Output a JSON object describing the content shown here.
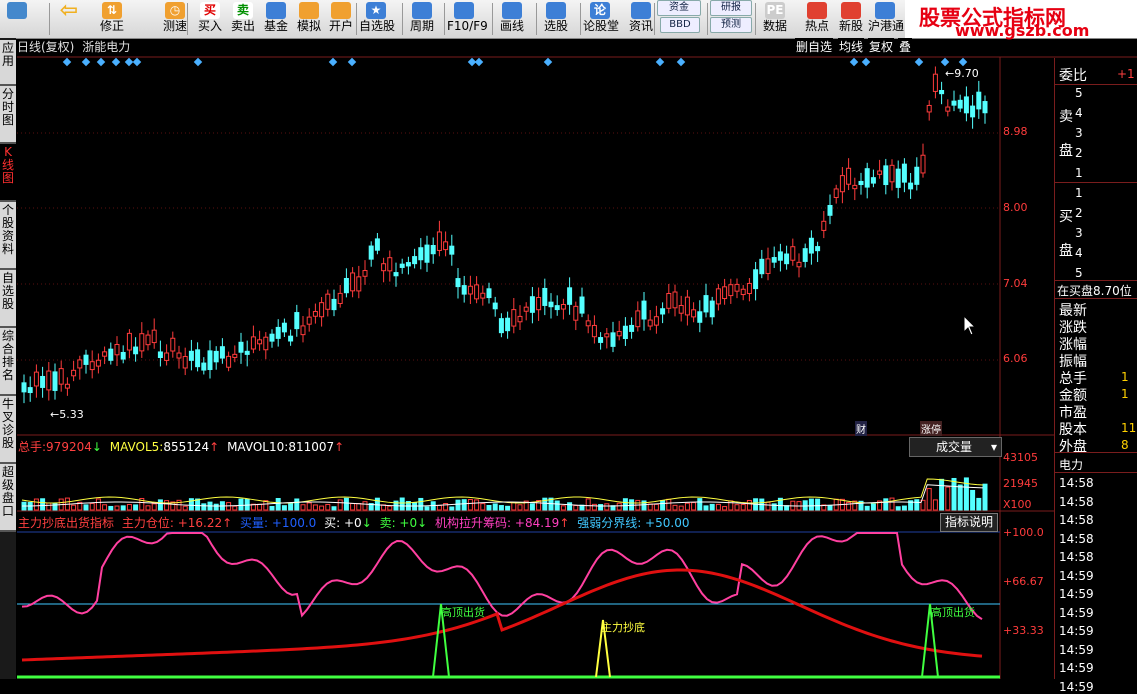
{
  "toolbar": {
    "items": [
      {
        "label": "",
        "icon": "app-icon"
      },
      {
        "label": "",
        "icon": "back-arrow-icon"
      },
      {
        "label": "修正",
        "icon": "arrow-updown-icon"
      },
      {
        "label": "测速",
        "icon": "clock-icon"
      },
      {
        "label": "买入",
        "icon": "buy-icon",
        "glyph": "买"
      },
      {
        "label": "卖出",
        "icon": "sell-icon",
        "glyph": "卖"
      },
      {
        "label": "基金",
        "icon": "fund-icon"
      },
      {
        "label": "模拟",
        "icon": "hammer-icon"
      },
      {
        "label": "开户",
        "icon": "account-icon"
      },
      {
        "label": "自选股",
        "icon": "star-icon"
      },
      {
        "label": "周期",
        "icon": "period-icon"
      },
      {
        "label": "F10/F9",
        "icon": "f10-icon"
      },
      {
        "label": "画线",
        "icon": "pen-icon"
      },
      {
        "label": "选股",
        "icon": "select-icon"
      },
      {
        "label": "论股堂",
        "icon": "forum-icon",
        "glyph": "论"
      },
      {
        "label": "资讯",
        "icon": "news-icon"
      },
      {
        "label": "数据",
        "icon": "pe-icon",
        "glyph": "PE"
      },
      {
        "label": "热点",
        "icon": "hot-icon"
      },
      {
        "label": "新股",
        "icon": "ipo-icon"
      },
      {
        "label": "沪港通",
        "icon": "hk-icon"
      }
    ],
    "mini_buttons": [
      "资金",
      "BBD",
      "研报",
      "预测"
    ]
  },
  "logo": {
    "title": "股票公式指标网",
    "url": "www.gszb.com"
  },
  "left_tabs": [
    "应用",
    "分时图",
    "K线图",
    "个股资料",
    "自选股",
    "综合排名",
    "牛叉诊股",
    "超级盘口"
  ],
  "kline": {
    "title_parts": [
      "日线(复权)",
      "浙能电力"
    ],
    "top_right_buttons": [
      "删自选",
      "均线",
      "复权",
      "叠"
    ],
    "high_label": "9.70",
    "low_label": "5.33",
    "price_ticks": [
      "8.98",
      "8.00",
      "7.04",
      "6.06"
    ],
    "event_badges": [
      "财",
      "涨停"
    ]
  },
  "volume": {
    "legend": [
      {
        "label": "总手:",
        "value": "979204",
        "arrow": "down",
        "color": "#ff4040"
      },
      {
        "label": "MAVOL5:",
        "value": "855124",
        "arrow": "up",
        "color": "#ffff40"
      },
      {
        "label": "MAVOL10:",
        "value": "811007",
        "arrow": "up",
        "color": "#ffffff"
      }
    ],
    "ticks": [
      "43105",
      "21945",
      "X100"
    ],
    "dropdown_label": "成交量"
  },
  "indicator": {
    "legend": [
      {
        "text": "主力抄底出货指标",
        "color": "#ff4040"
      },
      {
        "text": "主力仓位: +16.22",
        "arrow": "up",
        "color": "#ff4040"
      },
      {
        "text": "买量: +100.0",
        "color": "#2060ff"
      },
      {
        "text": "买: +0",
        "arrow": "down",
        "color": "#ffffff"
      },
      {
        "text": "卖: +0",
        "arrow": "down",
        "color": "#40ff40"
      },
      {
        "text": "机构拉升筹码: +84.19",
        "arrow": "up",
        "color": "#ff40c0"
      },
      {
        "text": "强弱分界线: +50.00",
        "color": "#40c8ff"
      }
    ],
    "ticks": [
      "+100.0",
      "+66.67",
      "+33.33"
    ],
    "signals": [
      "高顶出货",
      "主力抄底",
      "高顶出货"
    ],
    "explain_button": "指标说明"
  },
  "right_panel": {
    "weibi_label": "委比",
    "weibi_value": "+1",
    "sell_label_1": "卖",
    "sell_label_2": "盘",
    "sell_levels": [
      "5",
      "4",
      "3",
      "2",
      "1"
    ],
    "buy_label_1": "买",
    "buy_label_2": "盘",
    "buy_levels": [
      "1",
      "2",
      "3",
      "4",
      "5"
    ],
    "buy_queue": "在买盘8.70位",
    "stats": [
      {
        "label": "最新",
        "value": ""
      },
      {
        "label": "涨跌",
        "value": ""
      },
      {
        "label": "涨幅",
        "value": ""
      },
      {
        "label": "振幅",
        "value": ""
      },
      {
        "label": "总手",
        "value": "1"
      },
      {
        "label": "金额",
        "value": "1"
      },
      {
        "label": "市盈",
        "value": ""
      },
      {
        "label": "股本",
        "value": "11"
      },
      {
        "label": "外盘",
        "value": "8"
      }
    ],
    "section": "电力",
    "times": [
      "14:58",
      "14:58",
      "14:58",
      "14:58",
      "14:58",
      "14:59",
      "14:59",
      "14:59",
      "14:59",
      "14:59",
      "14:59",
      "14:59"
    ]
  }
}
